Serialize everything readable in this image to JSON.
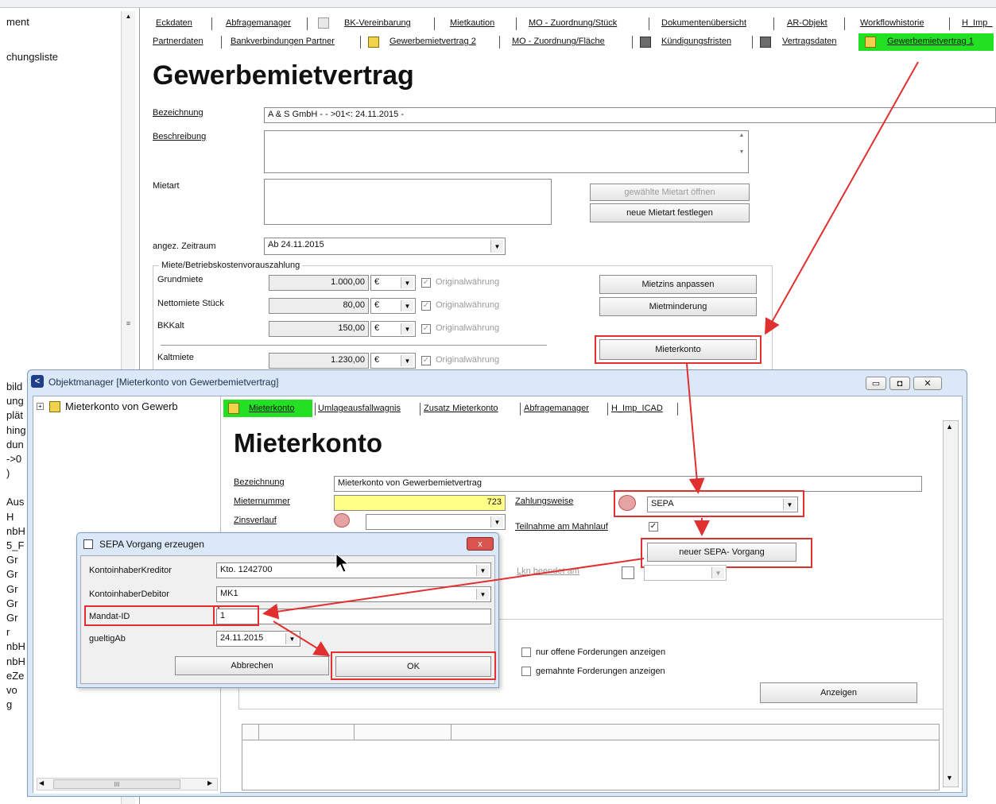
{
  "bg_left": {
    "top_items": [
      "ment",
      "chungsliste"
    ],
    "side_fragments": [
      "bild",
      "ung",
      "plät",
      "hing",
      "dun",
      "->0",
      ")",
      "Aus",
      "H",
      "nbH",
      "5_F",
      "Gr",
      "Gr",
      "Gr",
      "Gr",
      "Gr",
      "r",
      "nbH",
      "nbH",
      "eZe",
      "vo",
      "g"
    ]
  },
  "main_tabs_row1": [
    "Eckdaten",
    "Abfragemanager",
    "BK-Vereinbarung",
    "Mietkaution",
    "MO - Zuordnung/Stück",
    "Dokumentenübersicht",
    "AR-Objekt",
    "Workflowhistorie",
    "H_Imp_"
  ],
  "main_tabs_row2": [
    "Partnerdaten",
    "Bankverbindungen Partner",
    "Gewerbemietvertrag 2",
    "MO - Zuordnung/Fläche",
    "Kündigungsfristen",
    "Vertragsdaten",
    "Gewerbemietvertrag 1"
  ],
  "main_form": {
    "title": "Gewerbemietvertrag",
    "bezeichnung_label": "Bezeichnung",
    "bezeichnung_value": "A & S GmbH - - >01<: 24.11.2015 -",
    "beschreibung_label": "Beschreibung",
    "mietart_label": "Mietart",
    "btn_mietart_oeffnen": "gewählte Mietart öffnen",
    "btn_mietart_festlegen": "neue Mietart festlegen",
    "zeitraum_label": "angez. Zeitraum",
    "zeitraum_value": "Ab 24.11.2015",
    "group_label": "Miete/Betriebskostenvorauszahlung",
    "rows": [
      {
        "label": "Grundmiete",
        "value": "1.000,00",
        "currency": "€",
        "check_label": "Originalwährung"
      },
      {
        "label": "Nettomiete Stück",
        "value": "80,00",
        "currency": "€",
        "check_label": "Originalwährung"
      },
      {
        "label": "BKKalt",
        "value": "150,00",
        "currency": "€",
        "check_label": "Originalwährung"
      },
      {
        "label": "Kaltmiete",
        "value": "1.230,00",
        "currency": "€",
        "check_label": "Originalwährung"
      }
    ],
    "btn_mietzins": "Mietzins anpassen",
    "btn_mietminderung": "Mietminderung",
    "btn_mieterkonto": "Mieterkonto"
  },
  "om_window": {
    "title": "Objektmanager [Mieterkonto von Gewerbemietvertrag]",
    "tree_item": "Mieterkonto von Gewerb",
    "tabs": [
      "Mieterkonto",
      "Umlageausfallwagnis",
      "Zusatz Mieterkonto",
      "Abfragemanager",
      "H_Imp_ICAD"
    ],
    "heading": "Mieterkonto",
    "bezeichnung_label": "Bezeichnung",
    "bezeichnung_value": "Mieterkonto von Gewerbemietvertrag",
    "mieternummer_label": "Mieternummer",
    "mieternummer_value": "723",
    "zinsverlauf_label": "Zinsverlauf",
    "zahlungsweise_label": "Zahlungsweise",
    "zahlungsweise_value": "SEPA",
    "mahnlauf_label": "Teilnahme am Mahnlauf",
    "btn_neuer_sepa": "neuer SEPA- Vorgang",
    "beendet_label": "Lkn beendet am",
    "cb_offene": "nur offene Forderungen anzeigen",
    "cb_gemahnte": "gemahnte Forderungen anzeigen",
    "btn_anzeigen": "Anzeigen",
    "scroll_label": "III"
  },
  "sepa_dialog": {
    "title": "SEPA Vorgang erzeugen",
    "close_label": "x",
    "kreditor_label": "KontoinhaberKreditor",
    "kreditor_value": "Kto. 1242700",
    "debitor_label": "KontoinhaberDebitor",
    "debitor_value": "MK1",
    "mandat_label": "Mandat-ID",
    "mandat_value": "1",
    "gueltig_label": "gueltigAb",
    "gueltig_value": "24.11.2015",
    "btn_abbrechen": "Abbrechen",
    "btn_ok": "OK"
  },
  "colors": {
    "accent_tab": "#22e022",
    "highlight": "#e03030",
    "mieternummer_bg": "#ffff88",
    "title_bar": "#dbe8f7"
  }
}
